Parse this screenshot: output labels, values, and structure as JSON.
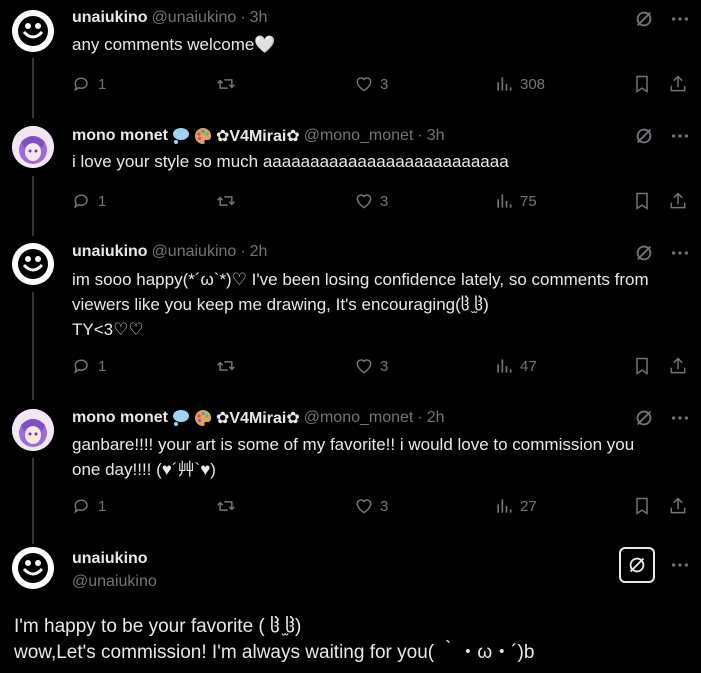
{
  "replies": [
    {
      "name": "unaiukino",
      "handle": "@unaiukino",
      "dot": "·",
      "time": "3h",
      "lines": [
        "any comments welcome🤍"
      ],
      "stats": {
        "replies": "1",
        "retweets": "",
        "likes": "3",
        "views": "308"
      }
    },
    {
      "name": "mono monet",
      "name_suffix": "✿V4Mirai✿",
      "handle": "@mono_monet",
      "dot": "·",
      "time": "3h",
      "lines": [
        "i love your style so much aaaaaaaaaaaaaaaaaaaaaaaaaa"
      ],
      "stats": {
        "replies": "1",
        "retweets": "",
        "likes": "3",
        "views": "75"
      }
    },
    {
      "name": "unaiukino",
      "handle": "@unaiukino",
      "dot": "·",
      "time": "2h",
      "lines": [
        "im sooo happy(*´ω`*)♡ I've been losing confidence lately, so comments from",
        "viewers like you keep me drawing, It's encouraging(ჱ̒ ̫ჱ̒)",
        "TY<3♡♡"
      ],
      "stats": {
        "replies": "1",
        "retweets": "",
        "likes": "3",
        "views": "47"
      }
    },
    {
      "name": "mono monet",
      "name_suffix": "✿V4Mirai✿",
      "handle": "@mono_monet",
      "dot": "·",
      "time": "2h",
      "lines": [
        "ganbare!!!! your art is some of my favorite!! i would love to commission you",
        "one day!!!! (♥´艸`♥)"
      ],
      "stats": {
        "replies": "1",
        "retweets": "",
        "likes": "3",
        "views": "27"
      }
    }
  ],
  "main_post": {
    "name": "unaiukino",
    "handle": "@unaiukino",
    "lines": [
      "I'm happy to be your favorite ( ჱ̒ ̫ჱ̒)",
      "wow,Let's commission! I'm always waiting for you( ｀・ω・´)b"
    ]
  },
  "colors": {
    "background": "#000000",
    "text": "#e7e9ea",
    "muted": "#71767b",
    "line": "#333639"
  }
}
